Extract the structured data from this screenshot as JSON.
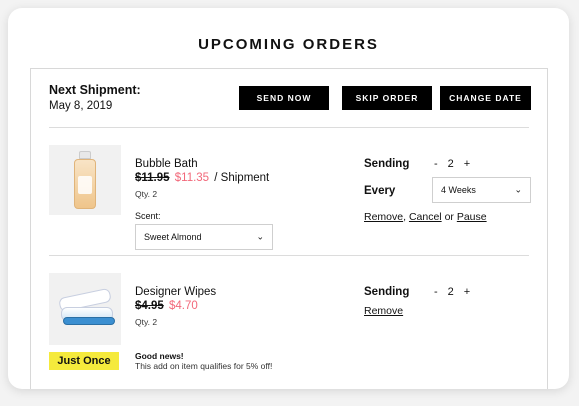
{
  "page": {
    "title": "UPCOMING ORDERS"
  },
  "shipment": {
    "label": "Next Shipment:",
    "date": "May 8, 2019"
  },
  "actions": {
    "send_now": "SEND NOW",
    "skip_order": "SKIP ORDER",
    "change_date": "CHANGE DATE"
  },
  "items": [
    {
      "name": "Bubble Bath",
      "old_price": "$11.95",
      "new_price": "$11.35",
      "price_suffix": "/ Shipment",
      "qty": "Qty. 2",
      "scent_label": "Scent:",
      "scent_value": "Sweet Almond",
      "sending_label": "Sending",
      "sending_qty": "2",
      "every_label": "Every",
      "every_value": "4 Weeks",
      "links": {
        "remove": "Remove",
        "comma": ",",
        "cancel": "Cancel",
        "or": "or",
        "pause": "Pause"
      }
    },
    {
      "name": "Designer Wipes",
      "old_price": "$4.95",
      "new_price": "$4.70",
      "qty": "Qty. 2",
      "badge": "Just Once",
      "sending_label": "Sending",
      "sending_qty": "2",
      "remove": "Remove",
      "news_title": "Good news!",
      "news_text": "This add on item qualifies for 5% off!"
    }
  ],
  "stepper": {
    "minus": "-",
    "plus": "+"
  },
  "colors": {
    "accent_sale": "#f2687a",
    "badge": "#f5ea3c",
    "button": "#000000"
  },
  "icons": {
    "chevron": "chevron-down-icon"
  }
}
